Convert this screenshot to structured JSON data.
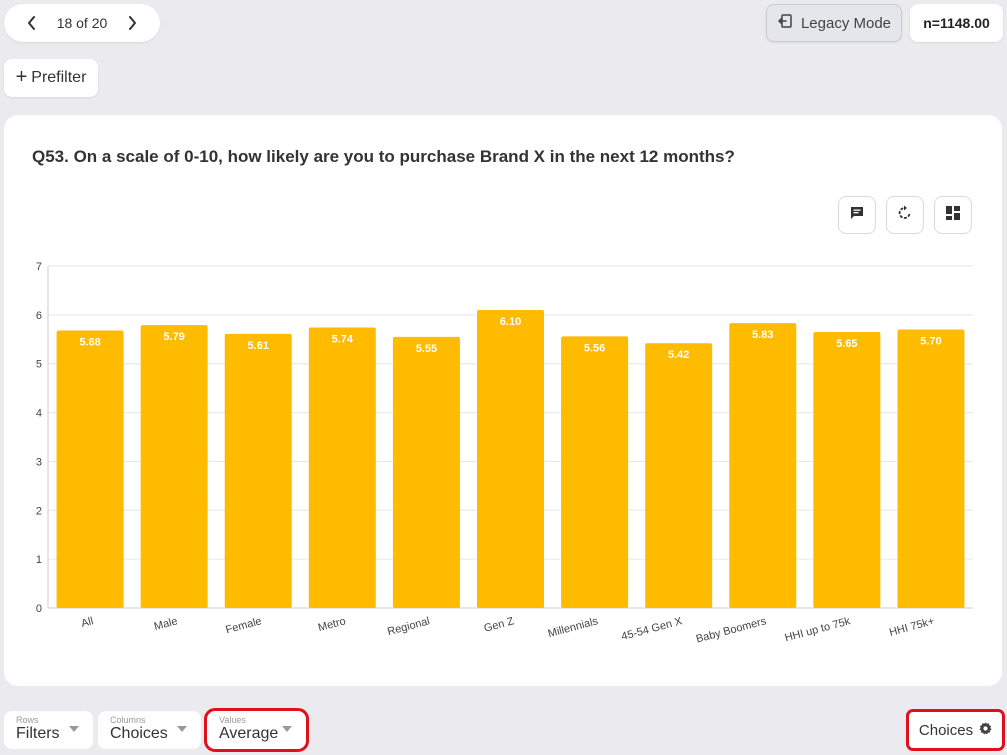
{
  "pager": {
    "label": "18 of 20",
    "prev_icon": "chevron-left-icon",
    "next_icon": "chevron-right-icon"
  },
  "header": {
    "legacy_mode": "Legacy Mode",
    "sample_size": "n=1148.00"
  },
  "prefilter": {
    "label": "Prefilter"
  },
  "card": {
    "question": "Q53. On a scale of 0-10, how likely are you to purchase Brand X in the next 12 months?"
  },
  "toolbar": {
    "icons": [
      "comment-icon",
      "refresh-icon",
      "layout-grid-icon"
    ]
  },
  "colors": {
    "bar": "#ffbb00",
    "label": "#ffffff",
    "highlight": "#e0101c"
  },
  "chart_data": {
    "type": "bar",
    "title": "",
    "categories": [
      "All",
      "Male",
      "Female",
      "Metro",
      "Regional",
      "Gen Z",
      "Millennials",
      "45-54 Gen X",
      "Baby Boomers",
      "HHI up to 75k",
      "HHI 75k+"
    ],
    "values": [
      5.68,
      5.79,
      5.61,
      5.74,
      5.55,
      6.1,
      5.56,
      5.42,
      5.83,
      5.65,
      5.7
    ],
    "value_labels": [
      "5.68",
      "5.79",
      "5.61",
      "5.74",
      "5.55",
      "6.10",
      "5.56",
      "5.42",
      "5.83",
      "5.65",
      "5.70"
    ],
    "ylim": [
      0,
      7
    ],
    "yticks": [
      "0",
      "1",
      "2",
      "3",
      "4",
      "5",
      "6",
      "7"
    ],
    "grid": true,
    "xlabel": "",
    "ylabel": ""
  },
  "bottom": {
    "rows": {
      "caption": "Rows",
      "value": "Filters"
    },
    "columns": {
      "caption": "Columns",
      "value": "Choices"
    },
    "values": {
      "caption": "Values",
      "value": "Average"
    },
    "choices_button": "Choices"
  }
}
